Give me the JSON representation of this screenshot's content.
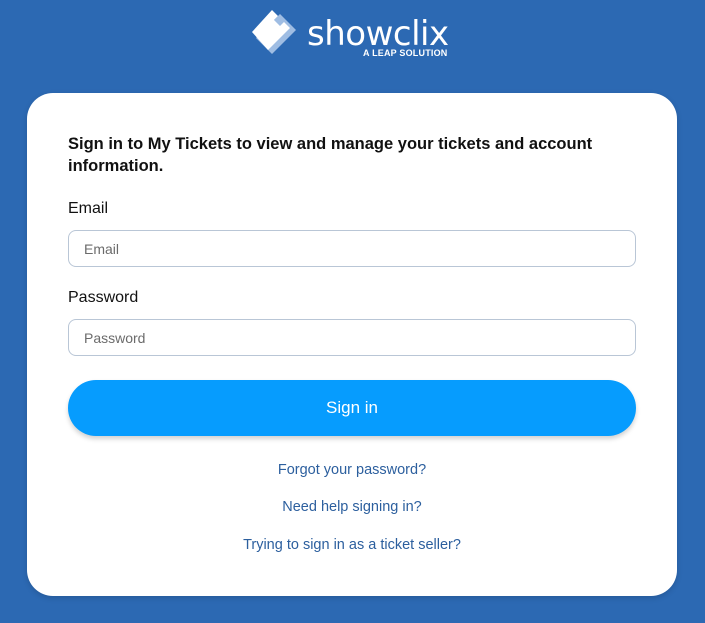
{
  "brand": {
    "name": "showclix",
    "tagline": "A LEAP SOLUTION"
  },
  "login": {
    "heading": "Sign in to My Tickets to view and manage your tickets and account information.",
    "email_label": "Email",
    "email_placeholder": "Email",
    "email_value": "",
    "password_label": "Password",
    "password_placeholder": "Password",
    "password_value": "",
    "signin_label": "Sign in"
  },
  "links": {
    "forgot": "Forgot your password?",
    "help": "Need help signing in?",
    "seller": "Trying to sign in as a ticket seller?"
  },
  "colors": {
    "background": "#2c69b3",
    "button": "#069cfe",
    "link": "#2c5f9e"
  }
}
